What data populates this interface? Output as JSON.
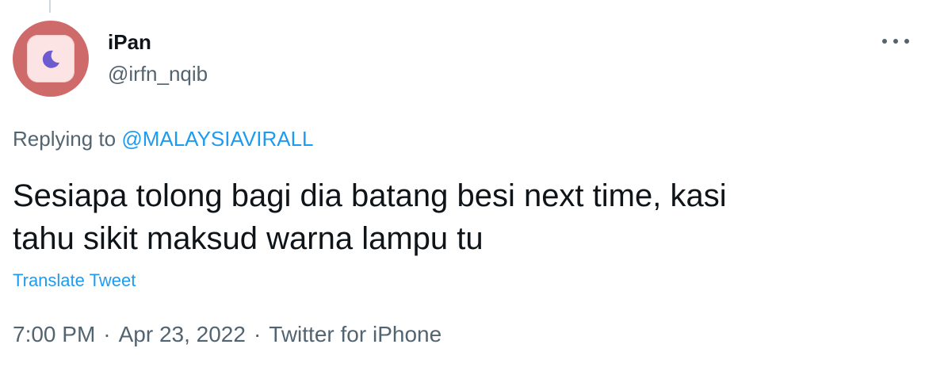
{
  "tweet": {
    "author": {
      "display_name": "iPan",
      "handle": "@irfn_nqib",
      "avatar_icon": "moon-icon"
    },
    "more_icon": "ellipsis-icon",
    "replying_prefix": "Replying to",
    "replying_to": "@MALAYSIAVIRALL",
    "text_lines": [
      "Sesiapa tolong bagi dia batang besi next time, kasi",
      "tahu sikit maksud warna lampu tu"
    ],
    "translate_label": "Translate Tweet",
    "time": "7:00 PM",
    "date": "Apr 23, 2022",
    "source": "Twitter for iPhone",
    "separator": "·"
  },
  "colors": {
    "text_primary": "#0f1419",
    "text_secondary": "#536471",
    "link": "#1d9bf0",
    "avatar_ring": "#cf6a6a",
    "avatar_tile": "#fde4e4",
    "moon": "#6d5bd0"
  }
}
